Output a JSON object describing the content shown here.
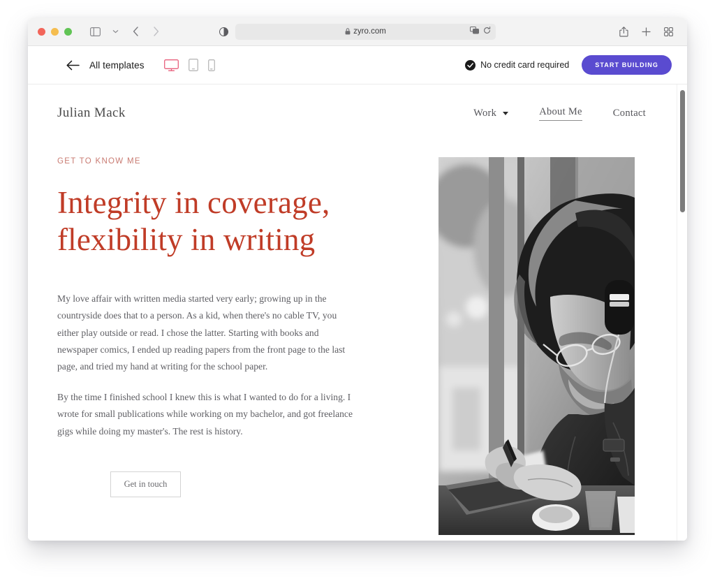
{
  "browser": {
    "url": "zyro.com",
    "lock_icon": "lock-icon",
    "reader_icon": "reader-view-icon",
    "sidebar_icon": "sidebar-toggle-icon",
    "back_icon": "back-arrow-icon",
    "forward_icon": "forward-arrow-icon",
    "share_icon": "share-icon",
    "newtab_icon": "plus-icon",
    "tabs_icon": "tab-overview-icon",
    "extensions_icon": "extensions-icon",
    "reload_icon": "reload-icon"
  },
  "zyro_toolbar": {
    "back_label": "back-arrow-icon",
    "all_templates": "All templates",
    "devices": [
      {
        "name": "desktop-view-icon",
        "active": true
      },
      {
        "name": "tablet-view-icon",
        "active": false
      },
      {
        "name": "mobile-view-icon",
        "active": false
      }
    ],
    "no_credit_card": "No credit card required",
    "check_icon": "check-circle-icon",
    "start_building": "START BUILDING",
    "accent_purple": "#5a4bd0",
    "accent_pink": "#e8607d"
  },
  "site": {
    "brand": "Julian Mack",
    "nav": [
      {
        "label": "Work",
        "has_caret": true,
        "active": false
      },
      {
        "label": "About Me",
        "has_caret": false,
        "active": true
      },
      {
        "label": "Contact",
        "has_caret": false,
        "active": false
      }
    ],
    "eyebrow": "GET TO KNOW ME",
    "headline_line1": "Integrity in coverage,",
    "headline_line2": "flexibility in writing",
    "paragraph1": "My love affair with written media started very early; growing up in the countryside does that to a person. As a kid, when there's no cable TV, you either play outside or read. I chose the latter. Starting with books and newspaper comics, I ended up reading papers from the front page to the last page, and tried my hand at writing for the school paper.",
    "paragraph2": "By the time I finished school I knew this is what I wanted to do for a living. I wrote for small publications while working on my bachelor, and got freelance gigs while doing my master's. The rest is history.",
    "cta": "Get in touch",
    "photo_alt": "bearded-man-with-headphones-writing-photo",
    "headline_color": "#c03c27",
    "eyebrow_color": "#c97b72"
  }
}
